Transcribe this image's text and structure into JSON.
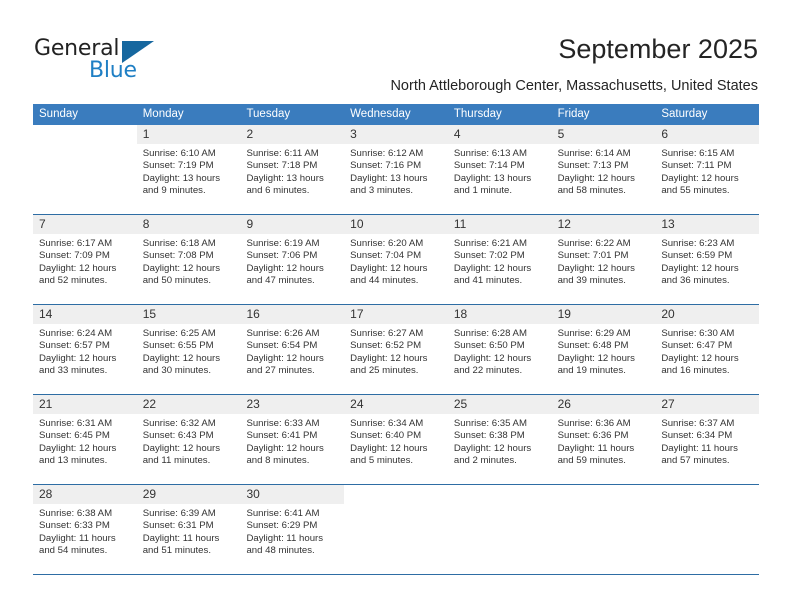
{
  "brand": {
    "name_part1": "General",
    "name_part2": "Blue"
  },
  "header": {
    "title": "September 2025",
    "subtitle": "North Attleborough Center, Massachusetts, United States"
  },
  "colors": {
    "header_band": "#3a7cbe",
    "row_divider": "#2e6da4",
    "daynum_band": "#efefef",
    "brand_blue": "#1f7fc4",
    "brand_triangle": "#16679f"
  },
  "calendar": {
    "weekdays": [
      "Sunday",
      "Monday",
      "Tuesday",
      "Wednesday",
      "Thursday",
      "Friday",
      "Saturday"
    ],
    "weeks": [
      [
        {
          "day": "",
          "sunrise": "",
          "sunset": "",
          "daylight1": "",
          "daylight2": ""
        },
        {
          "day": "1",
          "sunrise": "Sunrise: 6:10 AM",
          "sunset": "Sunset: 7:19 PM",
          "daylight1": "Daylight: 13 hours",
          "daylight2": "and 9 minutes."
        },
        {
          "day": "2",
          "sunrise": "Sunrise: 6:11 AM",
          "sunset": "Sunset: 7:18 PM",
          "daylight1": "Daylight: 13 hours",
          "daylight2": "and 6 minutes."
        },
        {
          "day": "3",
          "sunrise": "Sunrise: 6:12 AM",
          "sunset": "Sunset: 7:16 PM",
          "daylight1": "Daylight: 13 hours",
          "daylight2": "and 3 minutes."
        },
        {
          "day": "4",
          "sunrise": "Sunrise: 6:13 AM",
          "sunset": "Sunset: 7:14 PM",
          "daylight1": "Daylight: 13 hours",
          "daylight2": "and 1 minute."
        },
        {
          "day": "5",
          "sunrise": "Sunrise: 6:14 AM",
          "sunset": "Sunset: 7:13 PM",
          "daylight1": "Daylight: 12 hours",
          "daylight2": "and 58 minutes."
        },
        {
          "day": "6",
          "sunrise": "Sunrise: 6:15 AM",
          "sunset": "Sunset: 7:11 PM",
          "daylight1": "Daylight: 12 hours",
          "daylight2": "and 55 minutes."
        }
      ],
      [
        {
          "day": "7",
          "sunrise": "Sunrise: 6:17 AM",
          "sunset": "Sunset: 7:09 PM",
          "daylight1": "Daylight: 12 hours",
          "daylight2": "and 52 minutes."
        },
        {
          "day": "8",
          "sunrise": "Sunrise: 6:18 AM",
          "sunset": "Sunset: 7:08 PM",
          "daylight1": "Daylight: 12 hours",
          "daylight2": "and 50 minutes."
        },
        {
          "day": "9",
          "sunrise": "Sunrise: 6:19 AM",
          "sunset": "Sunset: 7:06 PM",
          "daylight1": "Daylight: 12 hours",
          "daylight2": "and 47 minutes."
        },
        {
          "day": "10",
          "sunrise": "Sunrise: 6:20 AM",
          "sunset": "Sunset: 7:04 PM",
          "daylight1": "Daylight: 12 hours",
          "daylight2": "and 44 minutes."
        },
        {
          "day": "11",
          "sunrise": "Sunrise: 6:21 AM",
          "sunset": "Sunset: 7:02 PM",
          "daylight1": "Daylight: 12 hours",
          "daylight2": "and 41 minutes."
        },
        {
          "day": "12",
          "sunrise": "Sunrise: 6:22 AM",
          "sunset": "Sunset: 7:01 PM",
          "daylight1": "Daylight: 12 hours",
          "daylight2": "and 39 minutes."
        },
        {
          "day": "13",
          "sunrise": "Sunrise: 6:23 AM",
          "sunset": "Sunset: 6:59 PM",
          "daylight1": "Daylight: 12 hours",
          "daylight2": "and 36 minutes."
        }
      ],
      [
        {
          "day": "14",
          "sunrise": "Sunrise: 6:24 AM",
          "sunset": "Sunset: 6:57 PM",
          "daylight1": "Daylight: 12 hours",
          "daylight2": "and 33 minutes."
        },
        {
          "day": "15",
          "sunrise": "Sunrise: 6:25 AM",
          "sunset": "Sunset: 6:55 PM",
          "daylight1": "Daylight: 12 hours",
          "daylight2": "and 30 minutes."
        },
        {
          "day": "16",
          "sunrise": "Sunrise: 6:26 AM",
          "sunset": "Sunset: 6:54 PM",
          "daylight1": "Daylight: 12 hours",
          "daylight2": "and 27 minutes."
        },
        {
          "day": "17",
          "sunrise": "Sunrise: 6:27 AM",
          "sunset": "Sunset: 6:52 PM",
          "daylight1": "Daylight: 12 hours",
          "daylight2": "and 25 minutes."
        },
        {
          "day": "18",
          "sunrise": "Sunrise: 6:28 AM",
          "sunset": "Sunset: 6:50 PM",
          "daylight1": "Daylight: 12 hours",
          "daylight2": "and 22 minutes."
        },
        {
          "day": "19",
          "sunrise": "Sunrise: 6:29 AM",
          "sunset": "Sunset: 6:48 PM",
          "daylight1": "Daylight: 12 hours",
          "daylight2": "and 19 minutes."
        },
        {
          "day": "20",
          "sunrise": "Sunrise: 6:30 AM",
          "sunset": "Sunset: 6:47 PM",
          "daylight1": "Daylight: 12 hours",
          "daylight2": "and 16 minutes."
        }
      ],
      [
        {
          "day": "21",
          "sunrise": "Sunrise: 6:31 AM",
          "sunset": "Sunset: 6:45 PM",
          "daylight1": "Daylight: 12 hours",
          "daylight2": "and 13 minutes."
        },
        {
          "day": "22",
          "sunrise": "Sunrise: 6:32 AM",
          "sunset": "Sunset: 6:43 PM",
          "daylight1": "Daylight: 12 hours",
          "daylight2": "and 11 minutes."
        },
        {
          "day": "23",
          "sunrise": "Sunrise: 6:33 AM",
          "sunset": "Sunset: 6:41 PM",
          "daylight1": "Daylight: 12 hours",
          "daylight2": "and 8 minutes."
        },
        {
          "day": "24",
          "sunrise": "Sunrise: 6:34 AM",
          "sunset": "Sunset: 6:40 PM",
          "daylight1": "Daylight: 12 hours",
          "daylight2": "and 5 minutes."
        },
        {
          "day": "25",
          "sunrise": "Sunrise: 6:35 AM",
          "sunset": "Sunset: 6:38 PM",
          "daylight1": "Daylight: 12 hours",
          "daylight2": "and 2 minutes."
        },
        {
          "day": "26",
          "sunrise": "Sunrise: 6:36 AM",
          "sunset": "Sunset: 6:36 PM",
          "daylight1": "Daylight: 11 hours",
          "daylight2": "and 59 minutes."
        },
        {
          "day": "27",
          "sunrise": "Sunrise: 6:37 AM",
          "sunset": "Sunset: 6:34 PM",
          "daylight1": "Daylight: 11 hours",
          "daylight2": "and 57 minutes."
        }
      ],
      [
        {
          "day": "28",
          "sunrise": "Sunrise: 6:38 AM",
          "sunset": "Sunset: 6:33 PM",
          "daylight1": "Daylight: 11 hours",
          "daylight2": "and 54 minutes."
        },
        {
          "day": "29",
          "sunrise": "Sunrise: 6:39 AM",
          "sunset": "Sunset: 6:31 PM",
          "daylight1": "Daylight: 11 hours",
          "daylight2": "and 51 minutes."
        },
        {
          "day": "30",
          "sunrise": "Sunrise: 6:41 AM",
          "sunset": "Sunset: 6:29 PM",
          "daylight1": "Daylight: 11 hours",
          "daylight2": "and 48 minutes."
        },
        {
          "day": "",
          "sunrise": "",
          "sunset": "",
          "daylight1": "",
          "daylight2": ""
        },
        {
          "day": "",
          "sunrise": "",
          "sunset": "",
          "daylight1": "",
          "daylight2": ""
        },
        {
          "day": "",
          "sunrise": "",
          "sunset": "",
          "daylight1": "",
          "daylight2": ""
        },
        {
          "day": "",
          "sunrise": "",
          "sunset": "",
          "daylight1": "",
          "daylight2": ""
        }
      ]
    ]
  }
}
